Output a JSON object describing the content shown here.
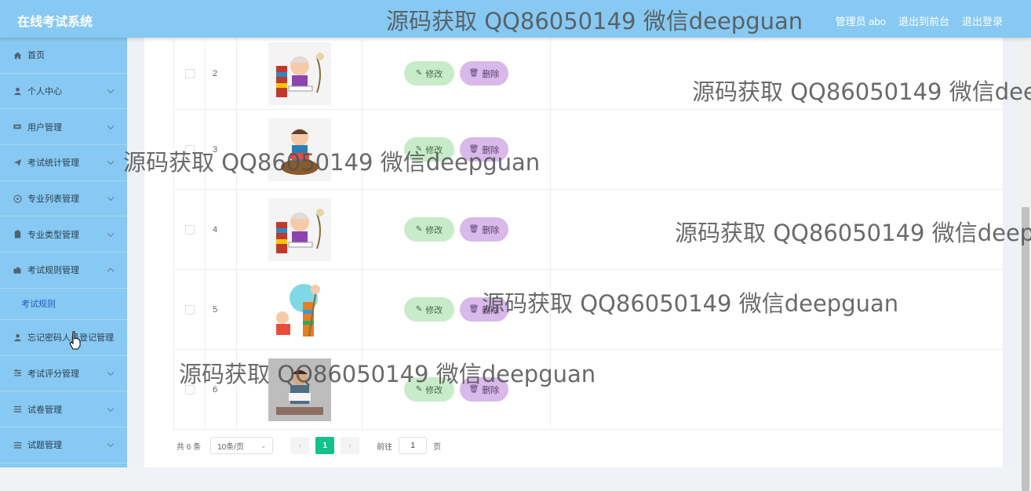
{
  "header": {
    "app_title": "在线考试系统",
    "links": [
      "管理员 abo",
      "退出到前台",
      "退出登录"
    ]
  },
  "watermark_text": "源码获取 QQ86050149 微信deepguan",
  "watermark_clipped": "源码获取 QQ86050149 微信dee",
  "watermark_clipped2": "源码获取 QQ86050149 微信deep",
  "sidebar": {
    "items": [
      {
        "label": "首页",
        "icon": "home-icon",
        "chevron": false
      },
      {
        "label": "个人中心",
        "icon": "user-icon",
        "chevron": true
      },
      {
        "label": "用户管理",
        "icon": "users-icon",
        "chevron": true
      },
      {
        "label": "考试统计管理",
        "icon": "send-icon",
        "chevron": true
      },
      {
        "label": "专业列表管理",
        "icon": "compass-icon",
        "chevron": true
      },
      {
        "label": "专业类型管理",
        "icon": "clipboard-icon",
        "chevron": true
      },
      {
        "label": "考试规则管理",
        "icon": "camera-icon",
        "chevron": true,
        "expanded": true
      },
      {
        "label": "忘记密码人员登记管理",
        "icon": "user-icon",
        "chevron": true
      },
      {
        "label": "考试评分管理",
        "icon": "sliders-icon",
        "chevron": true
      },
      {
        "label": "试卷管理",
        "icon": "list-icon",
        "chevron": true
      },
      {
        "label": "试题管理",
        "icon": "list-icon",
        "chevron": true
      }
    ],
    "sub_item": "考试规则"
  },
  "table": {
    "rows": [
      {
        "index": "2",
        "image": "reading-grandma"
      },
      {
        "index": "3",
        "image": "sitting-kid"
      },
      {
        "index": "4",
        "image": "reading-grandma"
      },
      {
        "index": "5",
        "image": "kids-books"
      },
      {
        "index": "6",
        "image": "man-reading"
      }
    ],
    "edit_label": "修改",
    "delete_label": "删除"
  },
  "pagination": {
    "total": "共 6 条",
    "page_size": "10条/页",
    "current_page": "1",
    "goto_prefix": "前往",
    "goto_value": "1",
    "goto_suffix": "页"
  },
  "colors": {
    "topbar": "#87c9f2",
    "sidebar": "#87c9f2",
    "edit_button": "#c8ebc9",
    "delete_button": "#d8b9ea",
    "page_active": "#13c28a"
  }
}
